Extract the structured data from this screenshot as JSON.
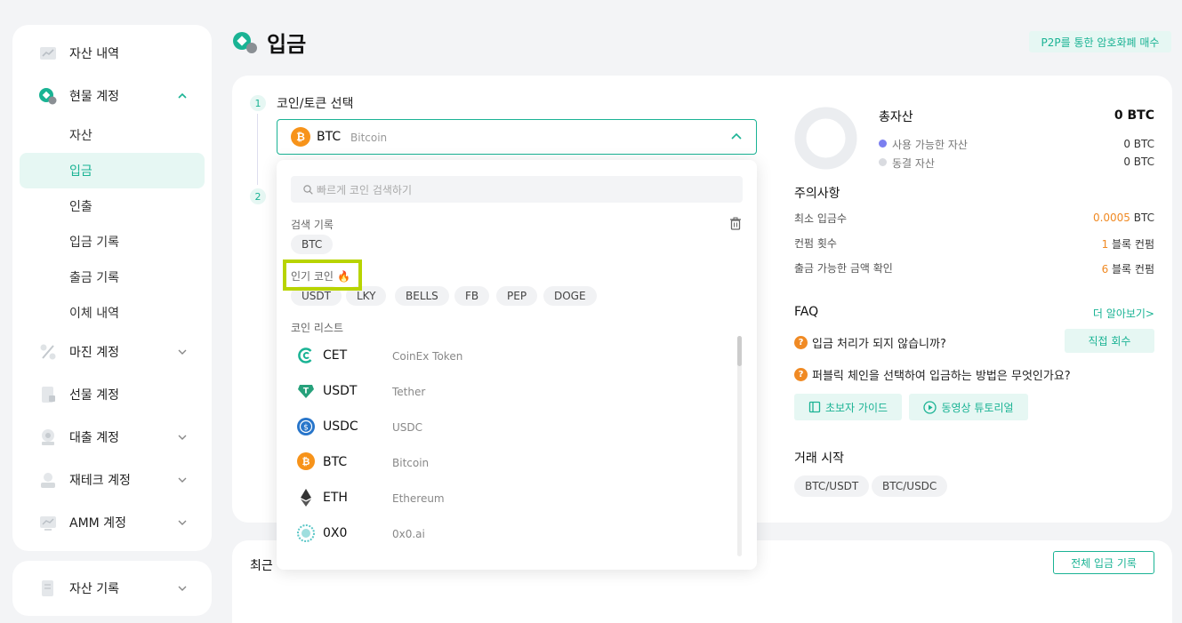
{
  "colors": {
    "accent": "#1ab394",
    "orange": "#f08a24",
    "btc": "#f7931a",
    "highlight": "#b8d400"
  },
  "sidebar": {
    "items": [
      {
        "label": "자산 내역",
        "icon": "chart-icon"
      },
      {
        "label": "현물 계정",
        "icon": "spot-icon",
        "expanded": true
      },
      {
        "label": "마진 계정",
        "icon": "margin-icon"
      },
      {
        "label": "선물 계정",
        "icon": "futures-icon"
      },
      {
        "label": "대출 계정",
        "icon": "loan-icon"
      },
      {
        "label": "재테크 계정",
        "icon": "finance-icon"
      },
      {
        "label": "AMM 계정",
        "icon": "amm-icon"
      }
    ],
    "sub_items": [
      "자산",
      "입금",
      "인출",
      "입금 기록",
      "출금 기록",
      "이체 내역"
    ],
    "bottom": {
      "label": "자산 기록",
      "icon": "record-icon"
    }
  },
  "header": {
    "title": "입금",
    "p2p_button": "P2P를 통한 암호화폐 매수"
  },
  "step1": {
    "num": "1",
    "label": "코인/토큰 선택"
  },
  "step2": {
    "num": "2"
  },
  "select": {
    "symbol": "BTC",
    "name": "Bitcoin"
  },
  "dropdown": {
    "search_placeholder": "빠르게 코인 검색하기",
    "history_title": "검색 기록",
    "history": [
      "BTC"
    ],
    "popular_title": "인기 코인",
    "popular_emoji": "🔥",
    "popular": [
      "USDT",
      "LKY",
      "BELLS",
      "FB",
      "PEP",
      "DOGE"
    ],
    "list_title": "코인 리스트",
    "coins": [
      {
        "symbol": "CET",
        "name": "CoinEx Token",
        "color": "#1ab394"
      },
      {
        "symbol": "USDT",
        "name": "Tether",
        "color": "#26a17b"
      },
      {
        "symbol": "USDC",
        "name": "USDC",
        "color": "#2775ca"
      },
      {
        "symbol": "BTC",
        "name": "Bitcoin",
        "color": "#f7931a"
      },
      {
        "symbol": "ETH",
        "name": "Ethereum",
        "color": "#333333"
      },
      {
        "symbol": "0X0",
        "name": "0x0.ai",
        "color": "#58c6c6"
      }
    ]
  },
  "assets": {
    "title": "총자산",
    "total": "0 BTC",
    "available_label": "사용 가능한 자산",
    "available": "0 BTC",
    "frozen_label": "동결 자산",
    "frozen": "0 BTC"
  },
  "notice": {
    "title": "주의사항",
    "rows": [
      {
        "label": "최소 입금수",
        "value": "0.0005",
        "unit": " BTC"
      },
      {
        "label": "컨펌 횟수",
        "value": "1",
        "unit": " 블록 컨펌"
      },
      {
        "label": "출금 가능한 금액 확인",
        "value": "6",
        "unit": " 블록 컨펌"
      }
    ]
  },
  "faq": {
    "title": "FAQ",
    "more": "더 알아보기>",
    "q1": "입금 처리가 되지 않습니까?",
    "recover_btn": "직접 회수",
    "q2": "퍼블릭 체인을 선택하여 입금하는 방법은 무엇인가요?",
    "guide_btn": "초보자 가이드",
    "video_btn": "동영상 튜토리얼"
  },
  "trade": {
    "title": "거래 시작",
    "pairs": [
      "BTC/USDT",
      "BTC/USDC"
    ]
  },
  "recent": {
    "title": "최근",
    "all_btn": "전체 입금 기록"
  }
}
